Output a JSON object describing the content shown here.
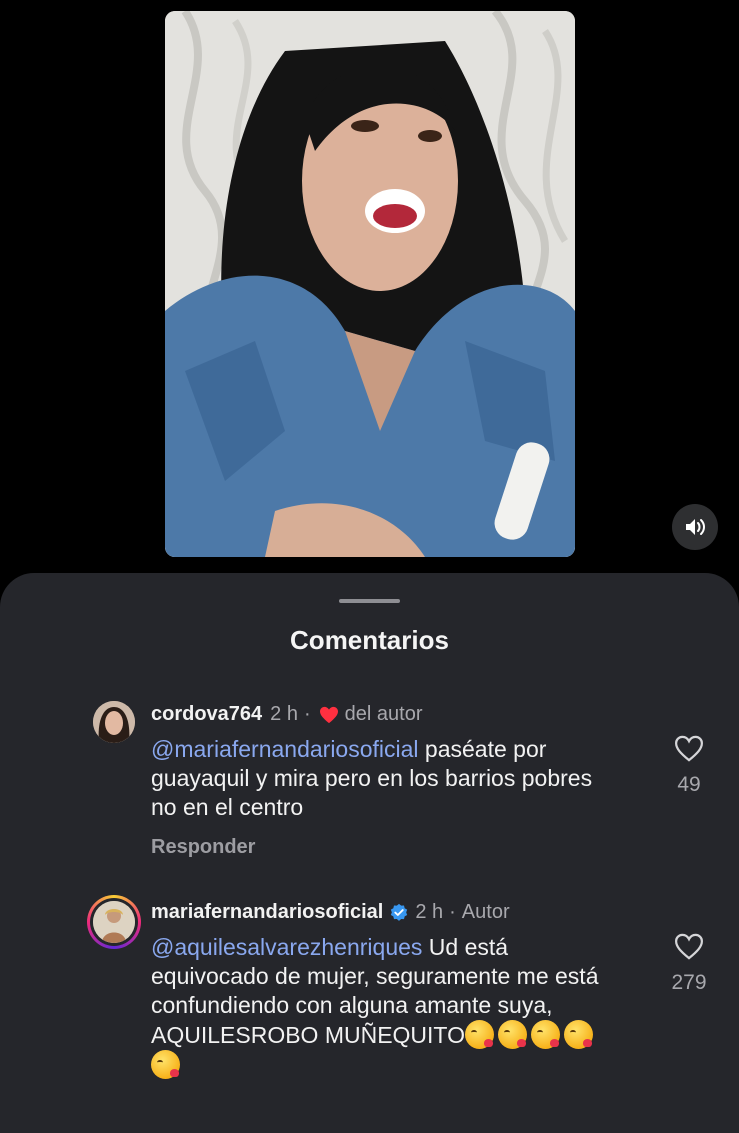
{
  "sheet": {
    "title": "Comentarios"
  },
  "comments": [
    {
      "username": "cordova764",
      "time": "2 h",
      "separator": "·",
      "liked_by_author": "del autor",
      "mention": "@mariafernandariosoficial",
      "text": " paséate por guayaquil y mira pero en los barrios pobres no en el centro",
      "reply_label": "Responder",
      "likes": "49"
    },
    {
      "username": "mariafernandariosoficial",
      "verified": true,
      "time": "2 h",
      "separator": "·",
      "author_label": "Autor",
      "mention": "@aquilesalvarezhenriques",
      "text": " Ud está equivocado de mujer, seguramente me está confundiendo con alguna amante suya, AQUILESROBO MUÑEQUITO",
      "emoji_count": 5,
      "emoji_name": "face-blowing-kiss",
      "likes": "279"
    }
  ],
  "colors": {
    "sheet_bg": "#25262b",
    "mention": "#8aa8ef",
    "heart_red": "#ff3040",
    "verified_blue": "#3897f0"
  }
}
